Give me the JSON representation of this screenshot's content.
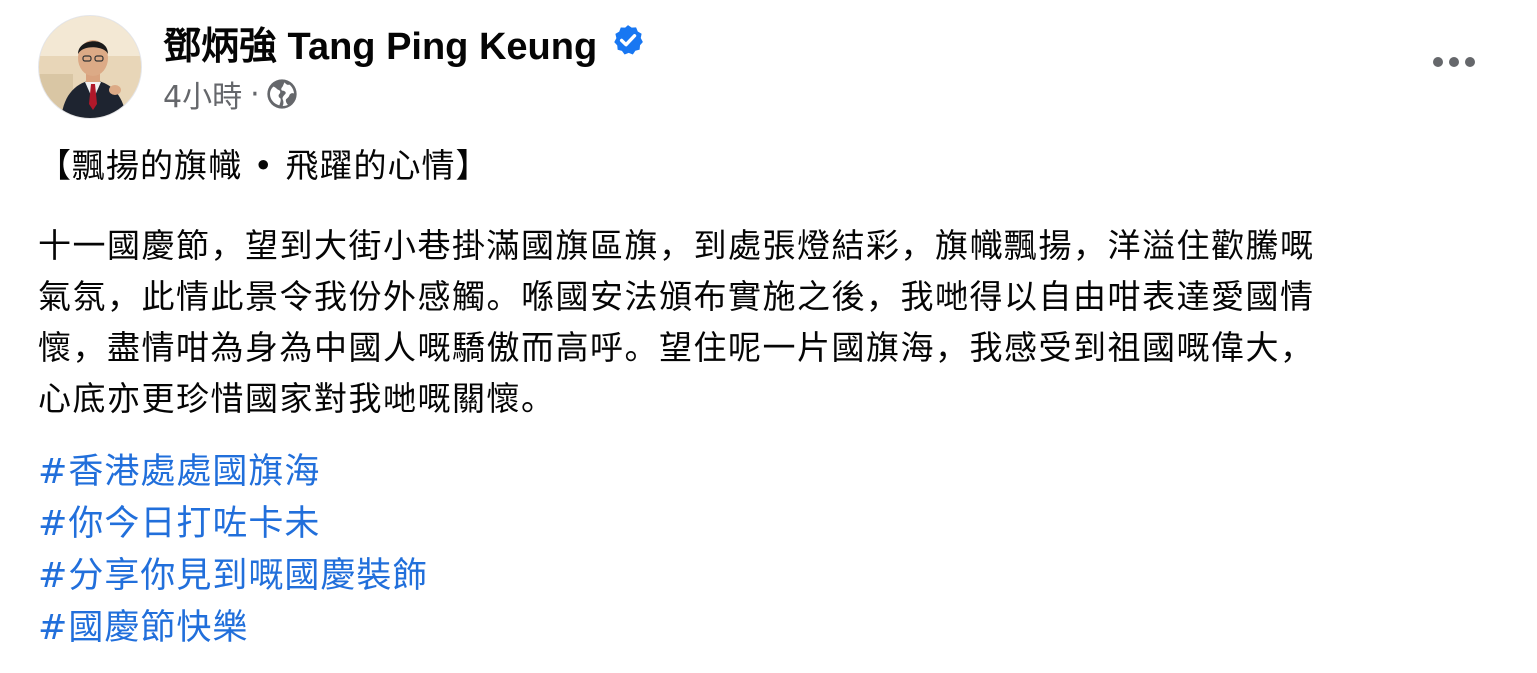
{
  "author": {
    "name": "鄧炳強 Tang Ping Keung",
    "verified_icon": "verified-badge-icon",
    "avatar_icon": "profile-photo"
  },
  "meta": {
    "time": "4小時",
    "separator": "·",
    "audience_icon": "globe-public-icon"
  },
  "actions": {
    "more_icon": "more-options-icon"
  },
  "post": {
    "heading": "【飄揚的旗幟 • 飛躍的心情】",
    "body_lines": [
      "十一國慶節，望到大街小巷掛滿國旗區旗，到處張燈結彩，旗幟飄揚，洋溢住歡騰嘅",
      "氣氛，此情此景令我份外感觸。喺國安法頒布實施之後，我哋得以自由咁表達愛國情",
      "懷，盡情咁為身為中國人嘅驕傲而高呼。望住呢一片國旗海，我感受到祖國嘅偉大，",
      "心底亦更珍惜國家對我哋嘅關懷。"
    ],
    "hashtags": [
      "#香港處處國旗海",
      "#你今日打咗卡未",
      "#分享你見到嘅國慶裝飾",
      "#國慶節快樂"
    ]
  },
  "colors": {
    "text": "#050505",
    "secondary": "#65676b",
    "link": "#216fdb",
    "verified": "#1877f2"
  }
}
